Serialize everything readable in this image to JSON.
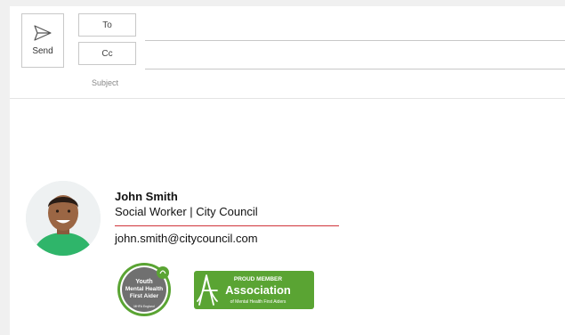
{
  "compose": {
    "send_label": "Send",
    "to_label": "To",
    "cc_label": "Cc",
    "subject_placeholder": "Subject"
  },
  "signature": {
    "name": "John Smith",
    "title": "Social Worker | City Council",
    "email": "john.smith@citycouncil.com",
    "accent_color": "#d1343a"
  },
  "badges": {
    "youth": {
      "line1": "Youth",
      "line2": "Mental Health",
      "line3": "First Aider",
      "footer": "MHFA England",
      "color": "#5aa433"
    },
    "association": {
      "top": "PROUD MEMBER",
      "main": "Association",
      "sub": "of Mental Health First Aiders",
      "color": "#5aa433"
    }
  }
}
